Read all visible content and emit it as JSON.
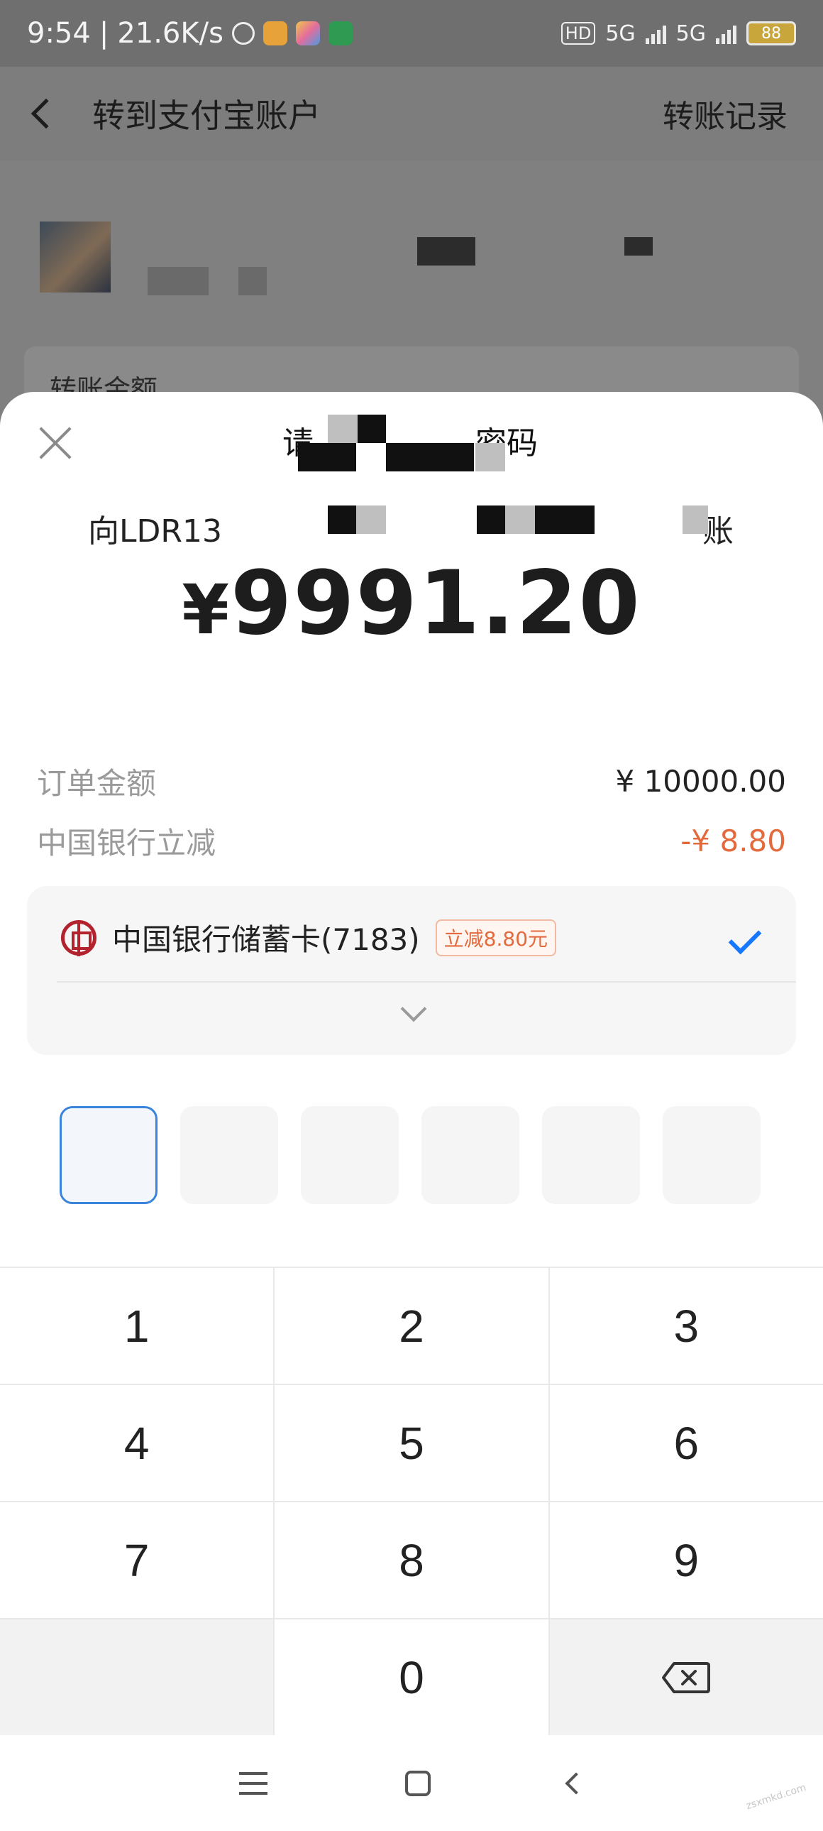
{
  "status_bar": {
    "time": "9:54",
    "speed": "21.6K/s",
    "hd": "HD",
    "net1": "5G",
    "net2": "5G",
    "battery": "88"
  },
  "background_page": {
    "title": "转到支付宝账户",
    "records_label": "转账记录",
    "amount_section_label": "转账金额"
  },
  "sheet": {
    "title_partial_left": "请",
    "title_partial_right": "密码",
    "payee_left": "向LDR13",
    "payee_right": "账",
    "amount_currency": "¥",
    "amount_value": "9991.20",
    "order_amount_label": "订单金额",
    "order_amount_value": "¥ 10000.00",
    "discount_label": "中国银行立减",
    "discount_value": "-¥ 8.80",
    "payment_method": "中国银行储蓄卡(7183)",
    "promo_tag": "立减8.80元",
    "pin_boxes": 6
  },
  "keypad": {
    "keys": [
      "1",
      "2",
      "3",
      "4",
      "5",
      "6",
      "7",
      "8",
      "9",
      "",
      "0",
      "⌫"
    ]
  },
  "colors": {
    "accent_blue": "#1677ff",
    "discount_orange": "#e36a3c",
    "boc_red": "#b3232e"
  }
}
